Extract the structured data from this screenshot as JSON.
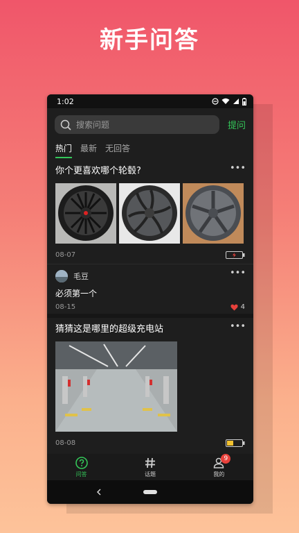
{
  "promo": {
    "title": "新手问答"
  },
  "status": {
    "time": "1:02"
  },
  "search": {
    "placeholder": "搜索问题",
    "ask_label": "提问"
  },
  "tabs": [
    {
      "label": "热门",
      "active": true
    },
    {
      "label": "最新",
      "active": false
    },
    {
      "label": "无回答",
      "active": false
    }
  ],
  "posts": [
    {
      "title": "你个更喜欢哪个轮毂?",
      "date": "08-07",
      "images": [
        "wheel-image",
        "wheel-image",
        "wheel-image"
      ],
      "status_icon": "battery-charging-icon"
    },
    {
      "type": "comment",
      "user": "毛豆",
      "text": "必须第一个",
      "date": "08-15",
      "likes": "4"
    },
    {
      "title": "猜猜这是哪里的超级充电站",
      "date": "08-08",
      "images": [
        "charging-station-image"
      ],
      "status_icon": "battery-half-icon"
    }
  ],
  "more_glyph": "•••",
  "bottom_nav": [
    {
      "label": "问答",
      "icon": "question-circle-icon",
      "active": true
    },
    {
      "label": "话题",
      "icon": "hashtag-icon",
      "active": false
    },
    {
      "label": "我的",
      "icon": "user-icon",
      "active": false,
      "badge": "9"
    }
  ],
  "colors": {
    "accent": "#34c759",
    "badge": "#e8413b",
    "background": "#1e1e1e"
  }
}
